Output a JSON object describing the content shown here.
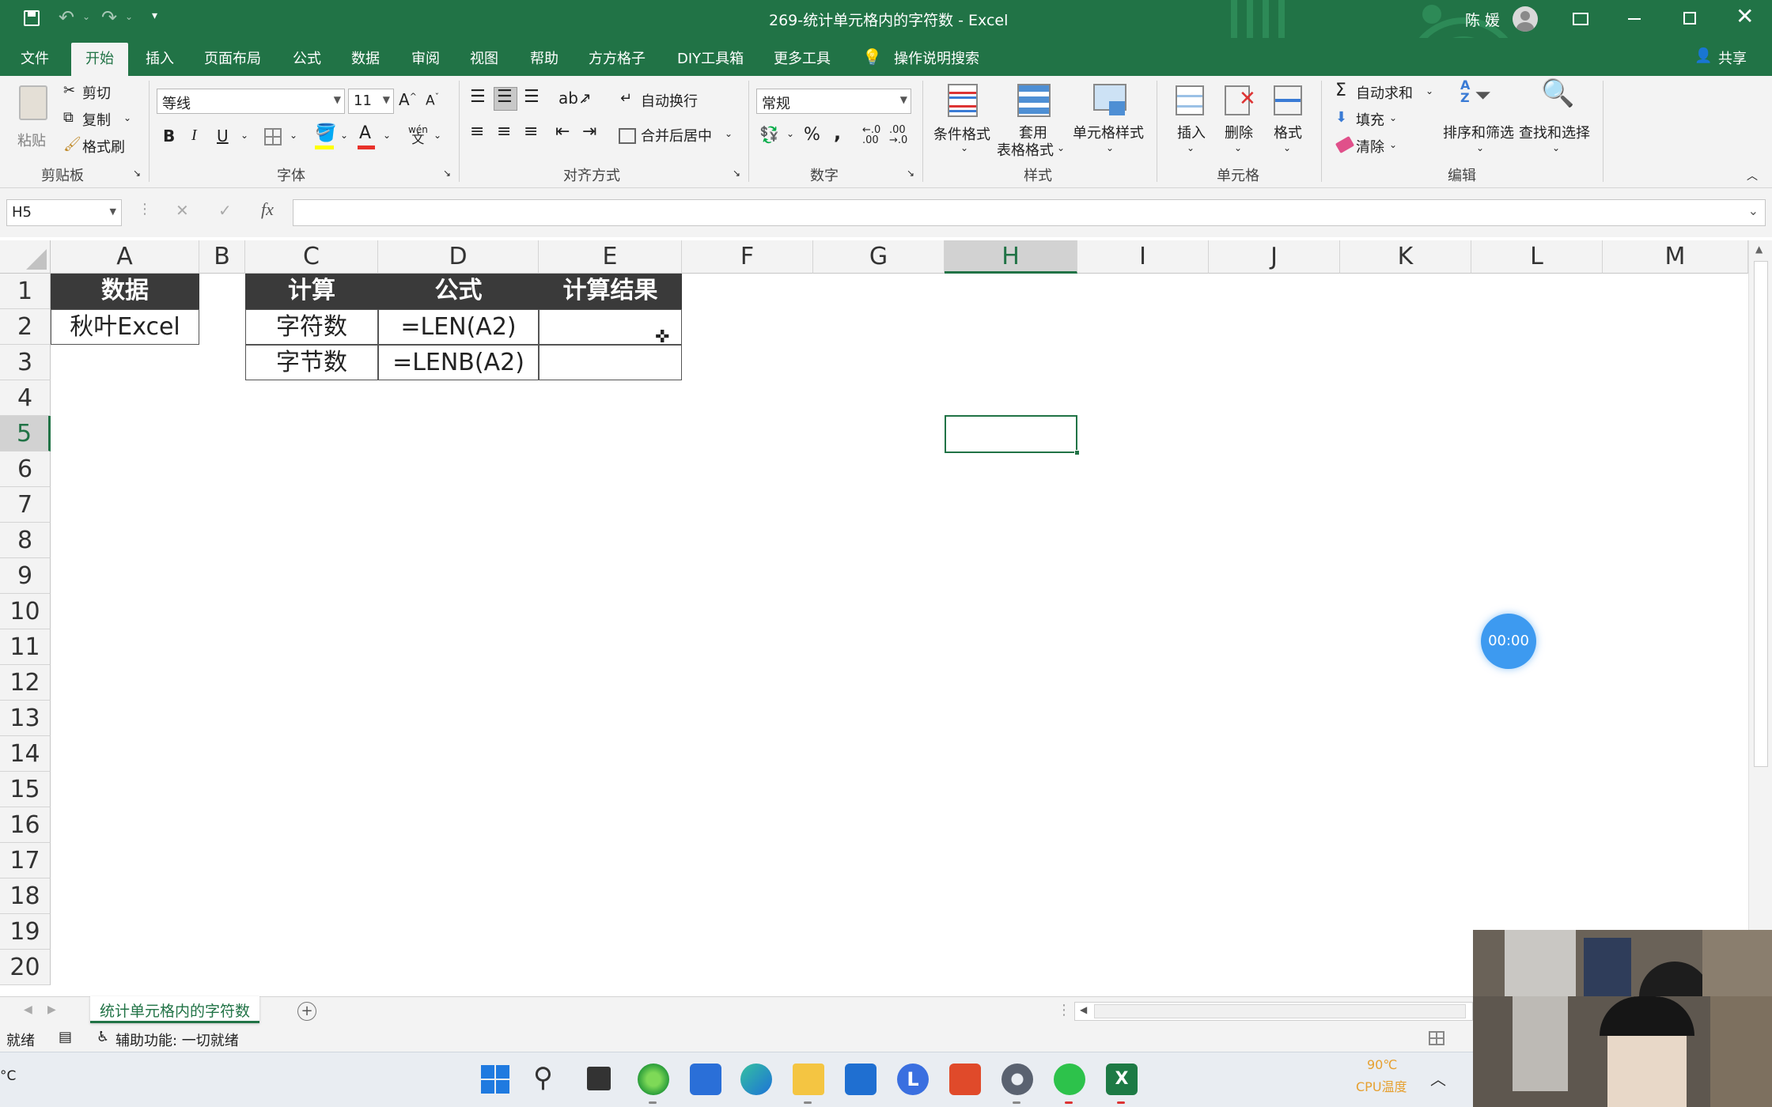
{
  "window": {
    "title": "269-统计单元格内的字符数  -  Excel",
    "user": "陈 媛"
  },
  "menu": {
    "items": [
      "文件",
      "开始",
      "插入",
      "页面布局",
      "公式",
      "数据",
      "审阅",
      "视图",
      "帮助",
      "方方格子",
      "DIY工具箱",
      "更多工具"
    ],
    "active": "开始",
    "tell_me": "操作说明搜索",
    "share": "共享"
  },
  "ribbon": {
    "clipboard": {
      "paste": "粘贴",
      "cut": "剪切",
      "copy": "复制",
      "format_painter": "格式刷",
      "group": "剪贴板"
    },
    "font": {
      "name": "等线",
      "size": "11",
      "group": "字体",
      "bold": "B",
      "italic": "I",
      "underline": "U",
      "phonetic_top": "wén",
      "phonetic_bottom": "文"
    },
    "alignment": {
      "wrap": "自动换行",
      "merge": "合并后居中",
      "group": "对齐方式"
    },
    "number": {
      "format": "常规",
      "group": "数字"
    },
    "styles": {
      "conditional": "条件格式",
      "table_line1": "套用",
      "table_line2": "表格格式",
      "cell_styles": "单元格样式",
      "group": "样式"
    },
    "cells": {
      "insert": "插入",
      "delete": "删除",
      "format": "格式",
      "group": "单元格"
    },
    "editing": {
      "autosum": "自动求和",
      "fill": "填充",
      "clear": "清除",
      "sort": "排序和筛选",
      "find": "查找和选择",
      "group": "编辑"
    }
  },
  "formula_bar": {
    "name_box": "H5",
    "formula": ""
  },
  "grid": {
    "columns": [
      "A",
      "B",
      "C",
      "D",
      "E",
      "F",
      "G",
      "H",
      "I",
      "J",
      "K",
      "L",
      "M"
    ],
    "rows": [
      "1",
      "2",
      "3",
      "4",
      "5",
      "6",
      "7",
      "8",
      "9",
      "10",
      "11",
      "12",
      "13",
      "14",
      "15",
      "16",
      "17",
      "18",
      "19",
      "20"
    ],
    "selected_col": "H",
    "selected_row": "5",
    "cells": {
      "A1": "数据",
      "A2": "秋叶Excel",
      "C1": "计算",
      "D1": "公式",
      "E1": "计算结果",
      "C2": "字符数",
      "D2": "=LEN(A2)",
      "C3": "字节数",
      "D3": "=LENB(A2)",
      "E2": "",
      "E3": ""
    }
  },
  "timer": "00:00",
  "sheet_tab": "统计单元格内的字符数",
  "status": {
    "ready": "就绪",
    "accessibility": "辅助功能: 一切就绪"
  },
  "taskbar": {
    "temp": "90℃",
    "temp_label": "CPU温度",
    "left_fragment": "°C"
  },
  "colors": {
    "excel_green": "#217346",
    "header_fill": "#3a3a3a",
    "timer_blue": "#3d9af0"
  }
}
